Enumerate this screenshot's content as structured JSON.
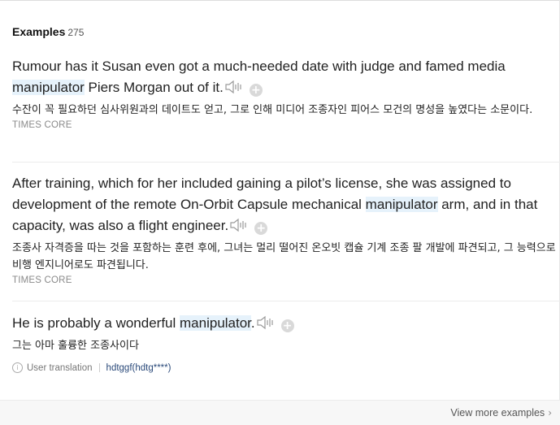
{
  "header": {
    "title": "Examples",
    "count": "275"
  },
  "examples": [
    {
      "en_before": "Rumour has it Susan even got a much-needed date with judge and famed media ",
      "en_highlight": "manipulator",
      "en_after": " Piers Morgan out of it.",
      "ko": "수잔이 꼭 필요하던 심사위원과의 데이트도 얻고, 그로 인해 미디어 조종자인 피어스 모건의 명성을 높였다는 소문이다.",
      "source": "TIMES CORE"
    },
    {
      "en_before": "After training, which for her included gaining a pilot’s license, she was assigned to development of the remote On-Orbit Capsule mechanical ",
      "en_highlight": "manipulator",
      "en_after": " arm, and in that capacity, was also a flight engineer.",
      "ko": "조종사 자격증을 따는 것을 포함하는 훈련 후에, 그녀는 멀리 떨어진 온오빗 캡슐 기계 조종 팔 개발에 파견되고, 그 능력으로 비행 엔지니어로도 파견됩니다.",
      "source": "TIMES CORE"
    },
    {
      "en_before": "He is probably a wonderful ",
      "en_highlight": "manipulator",
      "en_after": ".",
      "ko": "그는 아마 훌륭한 조종사이다",
      "translation_label": "User translation",
      "user": "hdtggf(hdtg****)"
    }
  ],
  "footer": {
    "more_label": "View more examples",
    "chevron": "›"
  },
  "icons": {
    "audio": "speaker-icon",
    "add": "plus-icon",
    "info": "info-icon"
  },
  "colors": {
    "highlight": "#e6f2fb",
    "user_link": "#2b4a7a",
    "source_gray": "#8a8a8a"
  }
}
